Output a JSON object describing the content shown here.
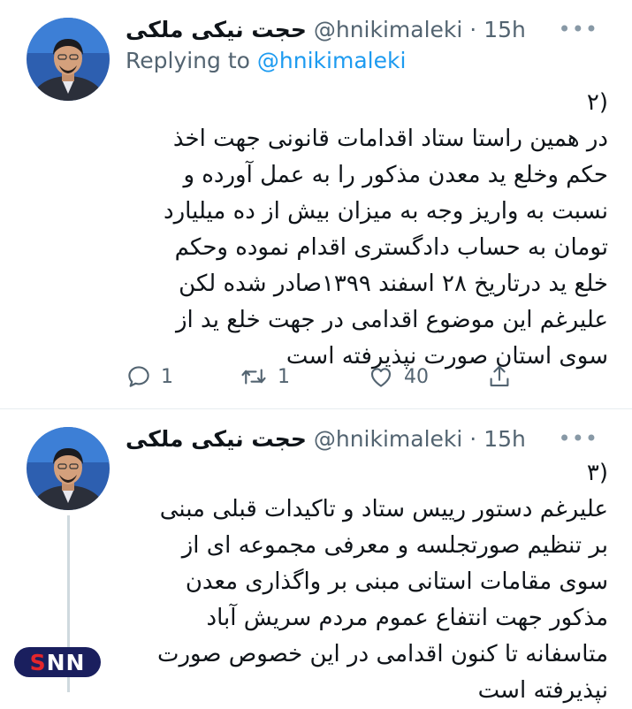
{
  "tweets": [
    {
      "author_name": "حجت نیکی ملکی",
      "handle": "@hnikimaleki",
      "separator": "·",
      "time": "15h",
      "more_icon": "•••",
      "replying_prefix": "Replying to",
      "replying_handle": "@hnikimaleki",
      "lines": [
        "۲)",
        "در همین راستا ستاد اقدامات قانونی جهت اخذ",
        "حکم وخلع ید معدن مذکور را به عمل آورده و",
        "نسبت به واریز وجه به میزان بیش از ده میلیارد",
        "تومان به حساب دادگستری اقدام نموده وحکم",
        "خلع ید درتاریخ ۲۸ اسفند ۱۳۹۹صادر شده لکن",
        "علیرغم این موضوع اقدامی در جهت خلع ید از",
        "سوی استان صورت نپذیرفته است"
      ],
      "replies": "1",
      "retweets": "1",
      "likes": "40"
    },
    {
      "author_name": "حجت نیکی ملکی",
      "handle": "@hnikimaleki",
      "separator": "·",
      "time": "15h",
      "more_icon": "•••",
      "lines": [
        "۳)",
        "علیرغم دستور رییس ستاد و تاکیدات قبلی مبنی",
        "بر تنظیم صورتجلسه و معرفی مجموعه ای از",
        "سوی مقامات استانی مبنی بر واگذاری معدن",
        "مذکور جهت انتفاع عموم مردم سریش آباد",
        "متاسفانه تا کنون اقدامی در این خصوص صورت",
        "نپذیرفته است"
      ]
    }
  ],
  "watermark": {
    "s": "S",
    "nn": "NN"
  },
  "colors": {
    "accent": "#1d9bf0",
    "text": "#0f1419",
    "secondary": "#536471",
    "watermark_bg": "#1a1f5e",
    "watermark_red": "#e4262b"
  },
  "icons": {
    "reply": "reply-icon",
    "retweet": "retweet-icon",
    "like": "heart-icon",
    "share": "share-icon",
    "more": "more-icon"
  }
}
